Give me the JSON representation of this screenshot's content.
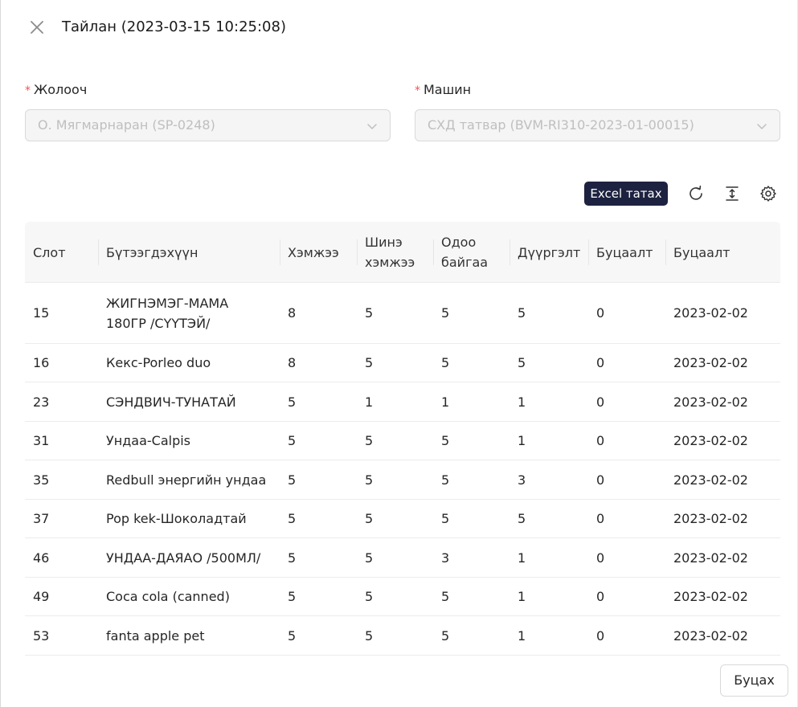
{
  "modal": {
    "title": "Тайлан (2023-03-15 10:25:08)"
  },
  "form": {
    "driver": {
      "label": "Жолооч",
      "value": "О. Мягмарнаран (SP-0248)"
    },
    "machine": {
      "label": "Машин",
      "value": "СХД татвар (BVM-RI310-2023-01-00015)"
    },
    "required_mark": "*"
  },
  "toolbar": {
    "excel_label": "Excel татах",
    "icons": [
      "refresh-icon",
      "density-icon",
      "settings-icon"
    ]
  },
  "table": {
    "columns": [
      "Слот",
      "Бүтээгдэхүүн",
      "Хэмжээ",
      "Шинэ\nхэмжээ",
      "Одоо\nбайгаа",
      "Дүүргэлт",
      "Буцаалт",
      "Буцаалт"
    ],
    "rows": [
      [
        "15",
        "ЖИГНЭМЭГ-МАМА 180ГР /СҮҮТЭЙ/",
        "8",
        "5",
        "5",
        "5",
        "0",
        "2023-02-02"
      ],
      [
        "16",
        "Кекс-Porleo duo",
        "8",
        "5",
        "5",
        "5",
        "0",
        "2023-02-02"
      ],
      [
        "23",
        "СЭНДВИЧ-ТУНАТАЙ",
        "5",
        "1",
        "1",
        "1",
        "0",
        "2023-02-02"
      ],
      [
        "31",
        "Ундаа-Calpis",
        "5",
        "5",
        "5",
        "1",
        "0",
        "2023-02-02"
      ],
      [
        "35",
        "Redbull энергийн ундаа",
        "5",
        "5",
        "5",
        "3",
        "0",
        "2023-02-02"
      ],
      [
        "37",
        "Pop kek-Шоколадтай",
        "5",
        "5",
        "5",
        "5",
        "0",
        "2023-02-02"
      ],
      [
        "46",
        "УНДАА-ДАЯАО /500МЛ/",
        "5",
        "5",
        "3",
        "1",
        "0",
        "2023-02-02"
      ],
      [
        "49",
        "Coca cola (canned)",
        "5",
        "5",
        "5",
        "1",
        "0",
        "2023-02-02"
      ],
      [
        "53",
        "fanta apple pet",
        "5",
        "5",
        "5",
        "1",
        "0",
        "2023-02-02"
      ]
    ]
  },
  "footer": {
    "back_label": "Буцах"
  },
  "colors": {
    "accent_dark": "#1d2240",
    "required": "#ff4d4f",
    "header_bg": "#f7f7f7"
  }
}
